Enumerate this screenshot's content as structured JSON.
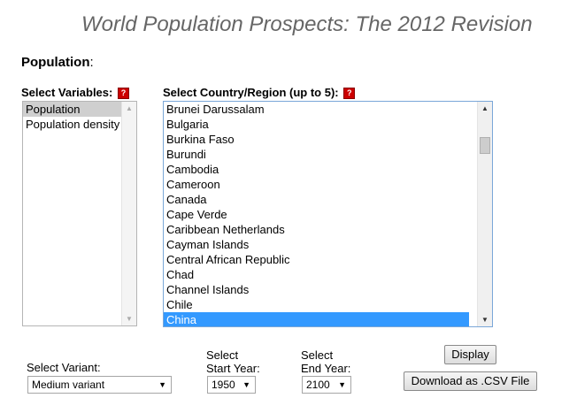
{
  "title": "World Population Prospects: The 2012 Revision",
  "section": {
    "label": "Population",
    "suffix": ":"
  },
  "variables": {
    "label": "Select Variables:",
    "help": "?",
    "items": [
      "Population",
      "Population density"
    ],
    "selected": "Population"
  },
  "countries": {
    "label": "Select Country/Region (up to 5):",
    "help": "?",
    "items": [
      "Brunei Darussalam",
      "Bulgaria",
      "Burkina Faso",
      "Burundi",
      "Cambodia",
      "Cameroon",
      "Canada",
      "Cape Verde",
      "Caribbean Netherlands",
      "Cayman Islands",
      "Central African Republic",
      "Chad",
      "Channel Islands",
      "Chile",
      "China"
    ],
    "selected": "China"
  },
  "variant": {
    "label": "Select Variant:",
    "value": "Medium variant"
  },
  "start_year": {
    "label_line1": "Select",
    "label_line2": "Start Year:",
    "value": "1950"
  },
  "end_year": {
    "label_line1": "Select",
    "label_line2": "End Year:",
    "value": "2100"
  },
  "buttons": {
    "display": "Display",
    "download": "Download as .CSV File"
  },
  "icons": {
    "help": "help-icon",
    "dropdown": "chevron-down-icon",
    "scroll_up": "arrow-up-icon",
    "scroll_down": "arrow-down-icon"
  }
}
